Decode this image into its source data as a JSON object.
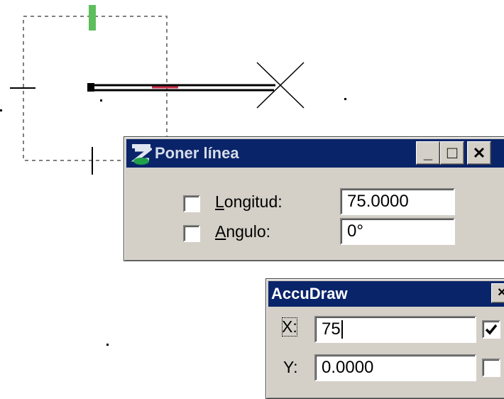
{
  "canvas": {
    "rubberband_color": "#7f7f7f",
    "handle_color": "#5cbf5c",
    "line_color": "#000000",
    "highlight_color": "#c8324b"
  },
  "place_line_dialog": {
    "title": "Poner línea",
    "app_icon": "microstation-icon",
    "minimize_glyph": "_",
    "maximize_glyph": "□",
    "close_glyph": "✕",
    "length": {
      "label_first": "L",
      "label_rest": "ongitud:",
      "value": "75.0000",
      "checked": false
    },
    "angle": {
      "label_first": "A",
      "label_rest": "ngulo:",
      "value": "0°",
      "checked": false
    }
  },
  "accudraw_dialog": {
    "title": "AccuDraw",
    "close_glyph": "✕",
    "x": {
      "label": "X:",
      "value": "75",
      "locked": true
    },
    "y": {
      "label": "Y:",
      "value": "0.0000",
      "locked": false
    }
  }
}
